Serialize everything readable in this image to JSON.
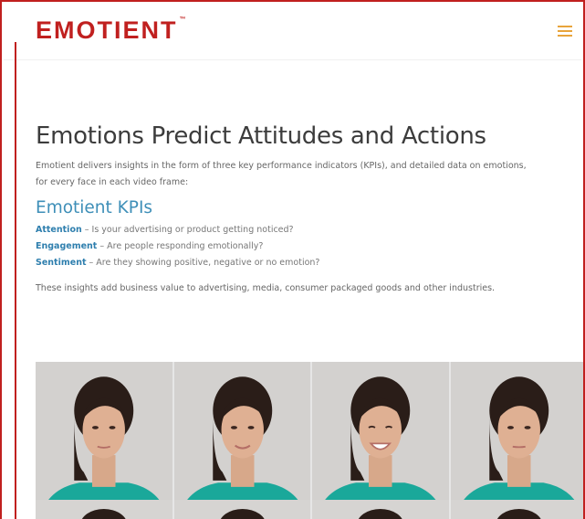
{
  "header": {
    "logo_text": "EMOTIENT",
    "logo_tm": "™",
    "menu_icon": "hamburger-menu-icon",
    "brand_color": "#c0201f",
    "menu_color": "#e8a43b"
  },
  "main": {
    "title": "Emotions Predict Attitudes and Actions",
    "intro_line1": "Emotient delivers insights in the form of three key performance indicators (KPIs), and detailed data on emotions,",
    "intro_line2": "for every face in each video frame:",
    "kpi_heading": "Emotient KPIs",
    "kpis": [
      {
        "term": "Attention",
        "description": " – Is your advertising or product getting noticed?"
      },
      {
        "term": "Engagement",
        "description": " – Are people responding emotionally?"
      },
      {
        "term": "Sentiment",
        "description": " – Are they showing positive, negative or no emotion?"
      }
    ],
    "closing": "These insights add business value to advertising, media, consumer packaged goods and other industries.",
    "accent_color": "#3e8fb8"
  },
  "gallery": {
    "tile_count": 4,
    "second_row_visible": true
  }
}
